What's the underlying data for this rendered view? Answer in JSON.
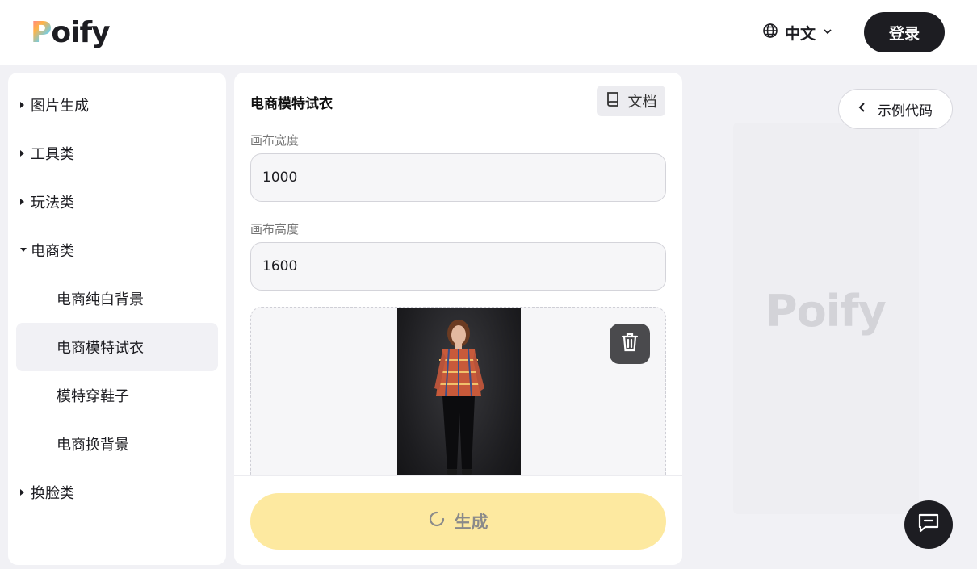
{
  "header": {
    "logo_text": "oify",
    "logo_initial": "P",
    "language": "中文",
    "login_label": "登录"
  },
  "sidebar": {
    "items": [
      {
        "label": "图片生成",
        "expanded": false
      },
      {
        "label": "工具类",
        "expanded": false
      },
      {
        "label": "玩法类",
        "expanded": false
      },
      {
        "label": "电商类",
        "expanded": true
      },
      {
        "label": "电商纯白背景"
      },
      {
        "label": "电商模特试衣",
        "active": true
      },
      {
        "label": "模特穿鞋子"
      },
      {
        "label": "电商换背景"
      },
      {
        "label": "换脸类",
        "expanded": false
      }
    ]
  },
  "form": {
    "title": "电商模特试衣",
    "doc_label": "文档",
    "width_label": "画布宽度",
    "width_value": "1000",
    "height_label": "画布高度",
    "height_value": "1600",
    "generate_label": "生成"
  },
  "preview": {
    "code_button_label": "示例代码",
    "watermark": "Poify"
  },
  "colors": {
    "dark": "#1d1d22",
    "generate_bg": "#fde9a0",
    "active_bg": "#f1f1f5"
  }
}
